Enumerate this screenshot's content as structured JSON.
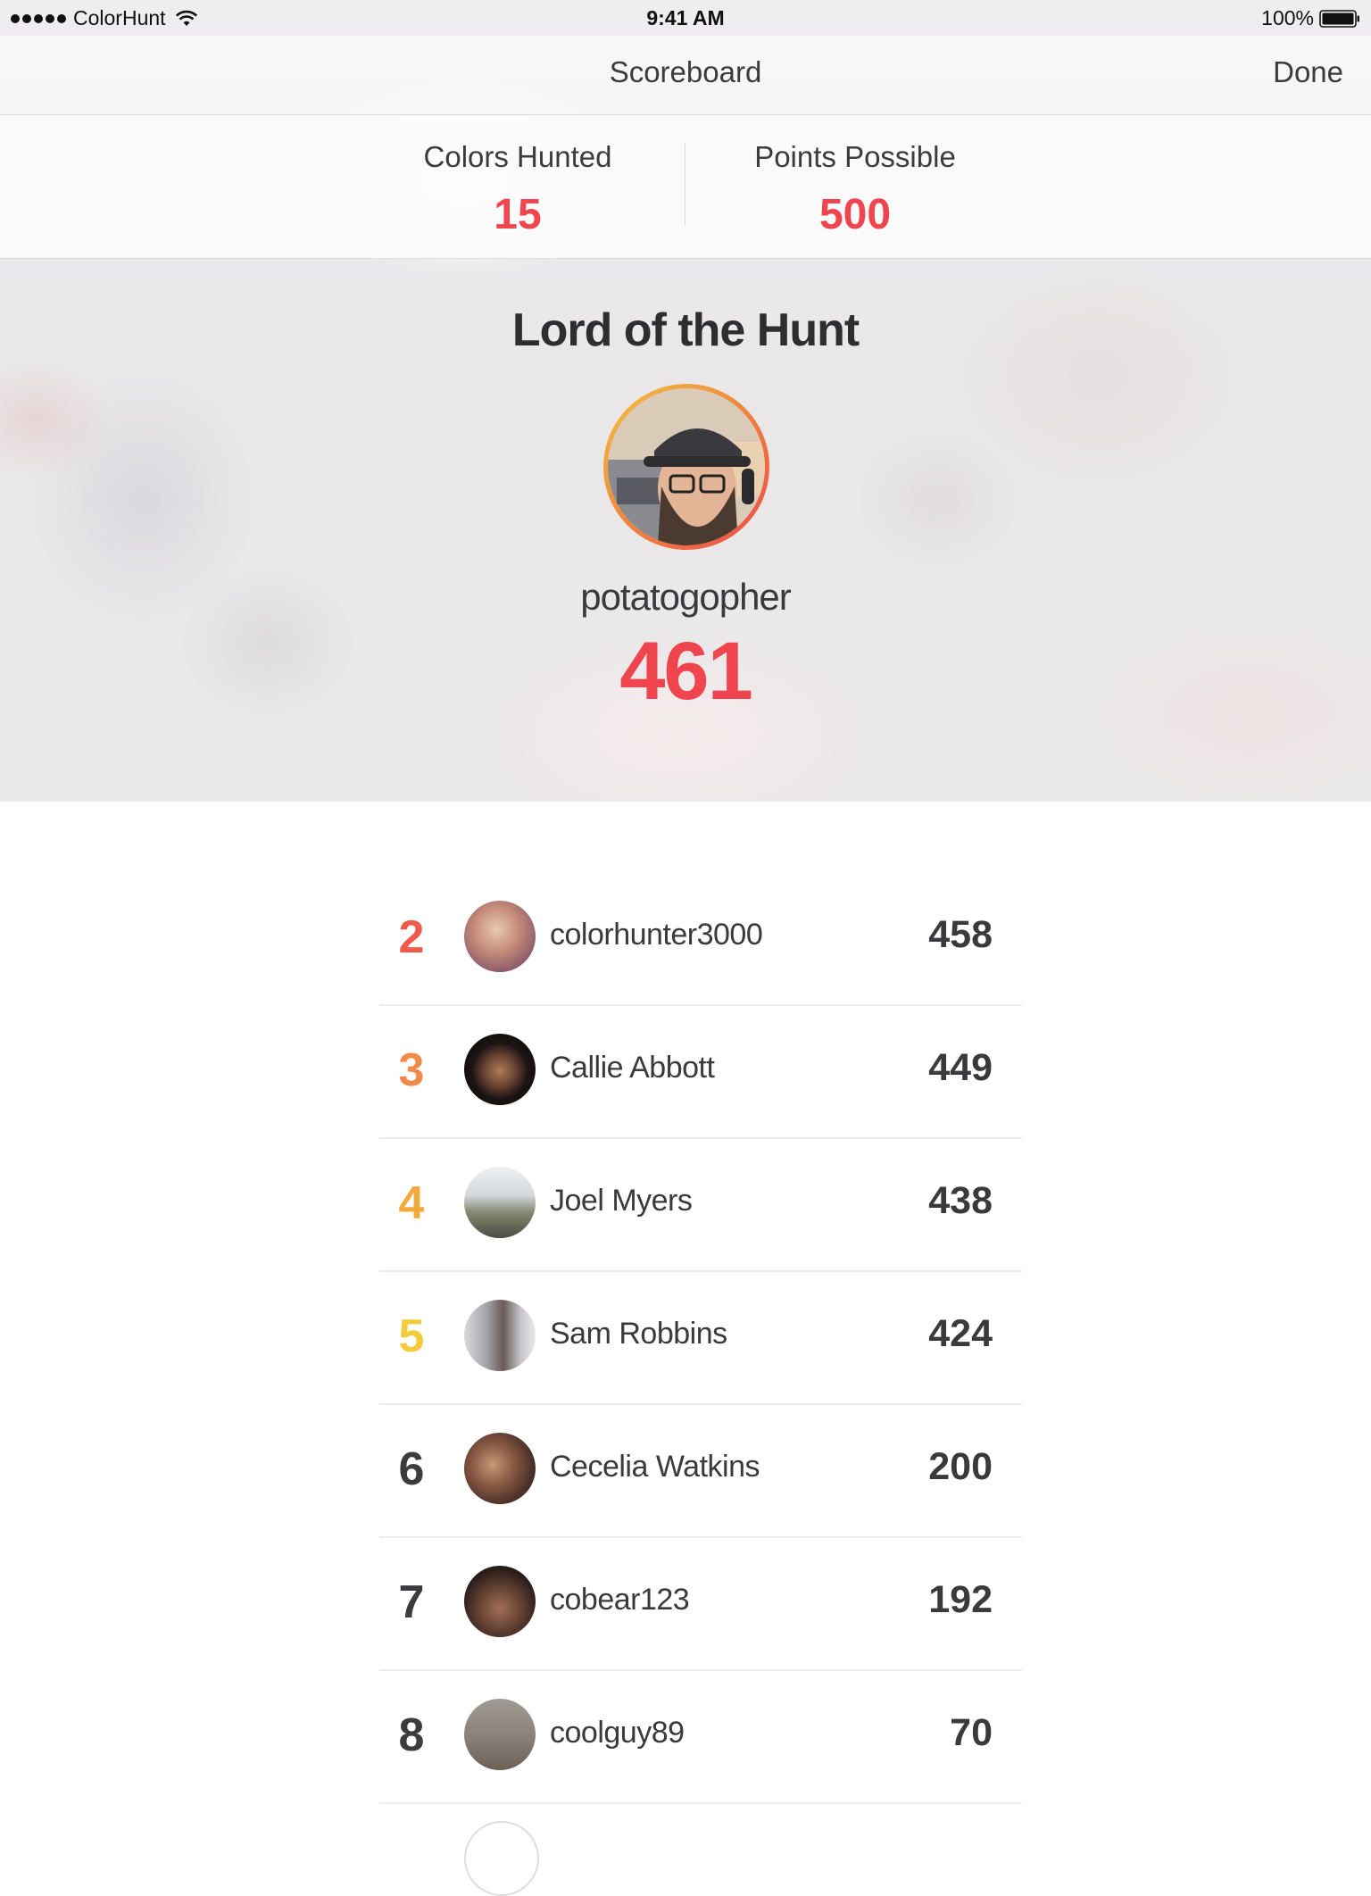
{
  "status_bar": {
    "carrier": "ColorHunt",
    "time": "9:41 AM",
    "battery": "100%"
  },
  "nav": {
    "title": "Scoreboard",
    "done_label": "Done"
  },
  "stats": {
    "colors_hunted_label": "Colors Hunted",
    "colors_hunted_value": "15",
    "points_possible_label": "Points Possible",
    "points_possible_value": "500"
  },
  "winner": {
    "title": "Lord of the Hunt",
    "name": "potatogopher",
    "score": "461"
  },
  "leaderboard": [
    {
      "rank": "2",
      "name": "colorhunter3000",
      "score": "458",
      "rank_color": "#f05a4a"
    },
    {
      "rank": "3",
      "name": "Callie Abbott",
      "score": "449",
      "rank_color": "#f08a4a"
    },
    {
      "rank": "4",
      "name": "Joel Myers",
      "score": "438",
      "rank_color": "#f2a93e"
    },
    {
      "rank": "5",
      "name": "Sam Robbins",
      "score": "424",
      "rank_color": "#f2cc3c"
    },
    {
      "rank": "6",
      "name": "Cecelia Watkins",
      "score": "200",
      "rank_color": "#3c3c3e"
    },
    {
      "rank": "7",
      "name": "cobear123",
      "score": "192",
      "rank_color": "#3c3c3e"
    },
    {
      "rank": "8",
      "name": "coolguy89",
      "score": "70",
      "rank_color": "#3c3c3e"
    }
  ],
  "colors": {
    "accent": "#f0454f",
    "text": "#3a3a3c"
  }
}
